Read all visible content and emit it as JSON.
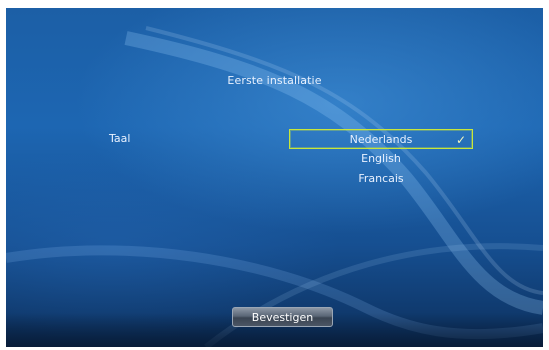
{
  "screen": {
    "title": "Eerste installatie"
  },
  "language": {
    "label": "Taal",
    "options": [
      "Nederlands",
      "English",
      "Francais"
    ],
    "selected": "Nederlands",
    "check_symbol": "✓"
  },
  "footer": {
    "confirm_label": "Bevestigen"
  },
  "colors": {
    "background": "#1d66b2",
    "selection_border": "#c8e63a",
    "text": "#e8f1ff"
  }
}
